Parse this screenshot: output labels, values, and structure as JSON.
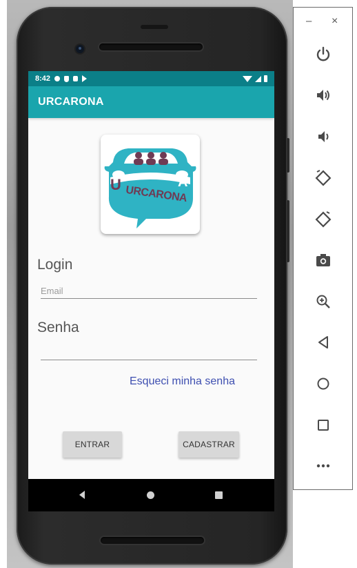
{
  "status_bar": {
    "time": "8:42"
  },
  "app": {
    "title": "URCARONA"
  },
  "logo": {
    "text": "URCARONA",
    "left_letter": "U",
    "right_letter": "A"
  },
  "login": {
    "login_label": "Login",
    "email_placeholder": "Email",
    "email_value": "",
    "senha_label": "Senha",
    "senha_value": "",
    "forgot_link": "Esqueci minha senha",
    "entrar_button": "ENTRAR",
    "cadastrar_button": "CADASTRAR"
  },
  "emulator_toolbar": {
    "minimize_label": "–",
    "close_label": "×",
    "items": [
      "power-icon",
      "volume-up-icon",
      "volume-down-icon",
      "rotate-left-icon",
      "rotate-right-icon",
      "camera-icon",
      "zoom-icon",
      "back-icon",
      "home-icon",
      "overview-icon",
      "more-icon"
    ]
  },
  "colors": {
    "status_bar": "#0b7f88",
    "app_bar": "#1aa5ad",
    "logo_teal": "#2fb3c4",
    "logo_maroon": "#6f3b54",
    "link": "#3e4fb0",
    "toolbar_icon": "#4a4a4a"
  }
}
